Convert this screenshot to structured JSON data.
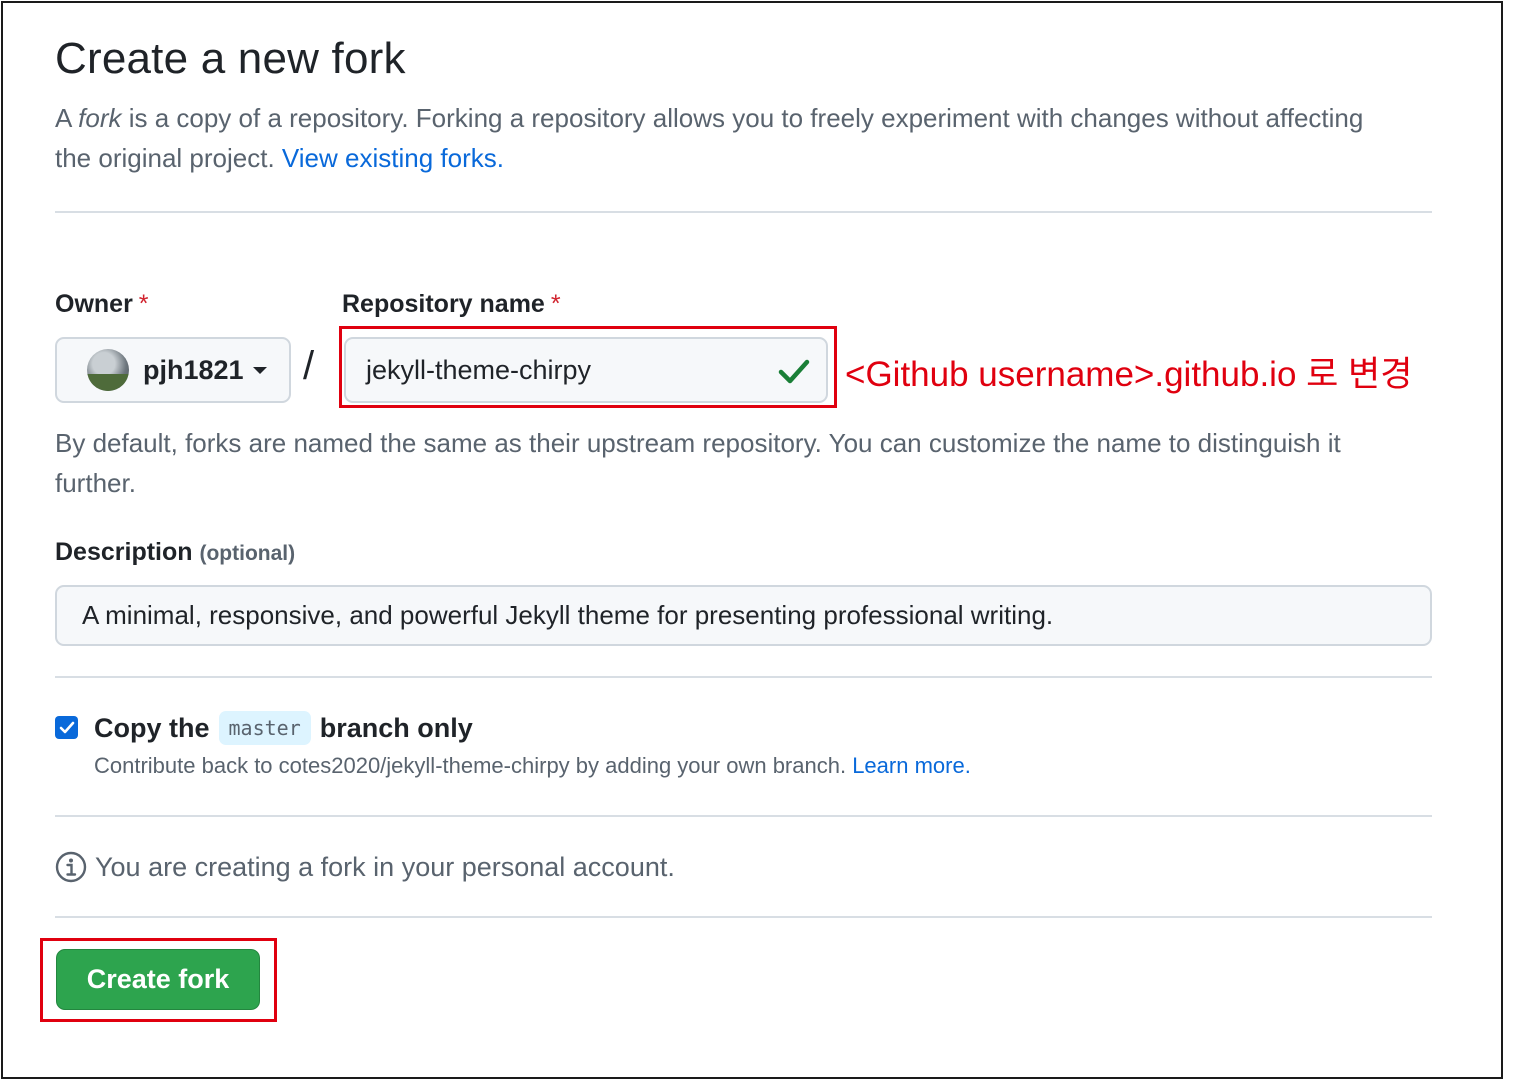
{
  "page": {
    "title": "Create a new fork",
    "lead_prefix": "A ",
    "lead_fork_word": "fork",
    "lead_text": " is a copy of a repository. Forking a repository allows you to freely experiment with changes without affecting the original project. ",
    "view_forks_link": "View existing forks."
  },
  "owner": {
    "label": "Owner",
    "required_mark": "*",
    "selected": "pjh1821"
  },
  "slash": "/",
  "repository": {
    "label": "Repository name",
    "required_mark": "*",
    "value": "jekyll-theme-chirpy",
    "valid": true,
    "help_text": "By default, forks are named the same as their upstream repository. You can customize the name to distinguish it further."
  },
  "annotation": {
    "text": "<Github username>.github.io 로 변경",
    "color": "#e0000f"
  },
  "description": {
    "label": "Description",
    "optional": "(optional)",
    "value": "A minimal, responsive, and powerful Jekyll theme for presenting professional writing."
  },
  "copy_branch": {
    "checked": true,
    "label_prefix": "Copy the",
    "branch": "master",
    "label_suffix": "branch only",
    "help_text": "Contribute back to cotes2020/jekyll-theme-chirpy by adding your own branch. ",
    "learn_more": "Learn more."
  },
  "info": {
    "icon": "info-icon",
    "text": "You are creating a fork in your personal account."
  },
  "submit": {
    "label": "Create fork",
    "color": "#2da44e"
  }
}
